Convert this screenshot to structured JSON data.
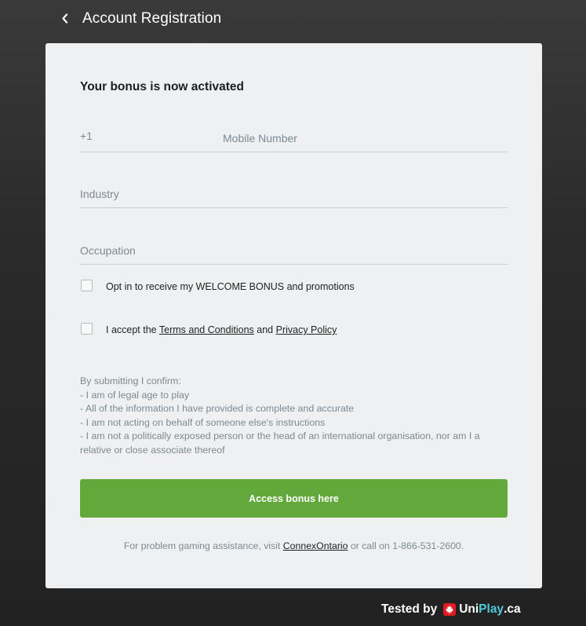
{
  "header": {
    "title": "Account Registration"
  },
  "form": {
    "heading": "Your bonus is now activated",
    "phone": {
      "prefix": "+1",
      "placeholder": "Mobile Number"
    },
    "industry": {
      "placeholder": "Industry"
    },
    "occupation": {
      "placeholder": "Occupation"
    },
    "optin": {
      "label": "Opt in to receive my WELCOME BONUS and promotions"
    },
    "terms": {
      "prefix": "I accept the",
      "terms_link": "Terms and Conditions",
      "and": "and",
      "privacy_link": "Privacy Policy"
    },
    "disclaimer": [
      "By submitting I confirm:",
      "- I am of legal age to play",
      "- All of the information I have provided is complete and accurate",
      "- I am not acting on behalf of someone else's instructions",
      "- I am not a politically exposed person or the head of an international organisation, nor am I a relative or close associate thereof"
    ],
    "submit_label": "Access bonus here",
    "assist": {
      "before": "For problem gaming assistance, visit",
      "link": "ConnexOntario",
      "after": "or call on 1-866-531-2600."
    }
  },
  "footer": {
    "tested_by": "Tested by",
    "brand_part1": "Uni",
    "brand_part2": "Play",
    "brand_part3": ".ca"
  },
  "colors": {
    "accent_green": "#62a83a",
    "card_bg": "#eef0f1",
    "muted_text": "#7d8a91",
    "brand_blue": "#4fc9d6",
    "brand_red": "#e31b23"
  },
  "icons": [
    "chevron-left-icon",
    "maple-leaf-icon"
  ]
}
